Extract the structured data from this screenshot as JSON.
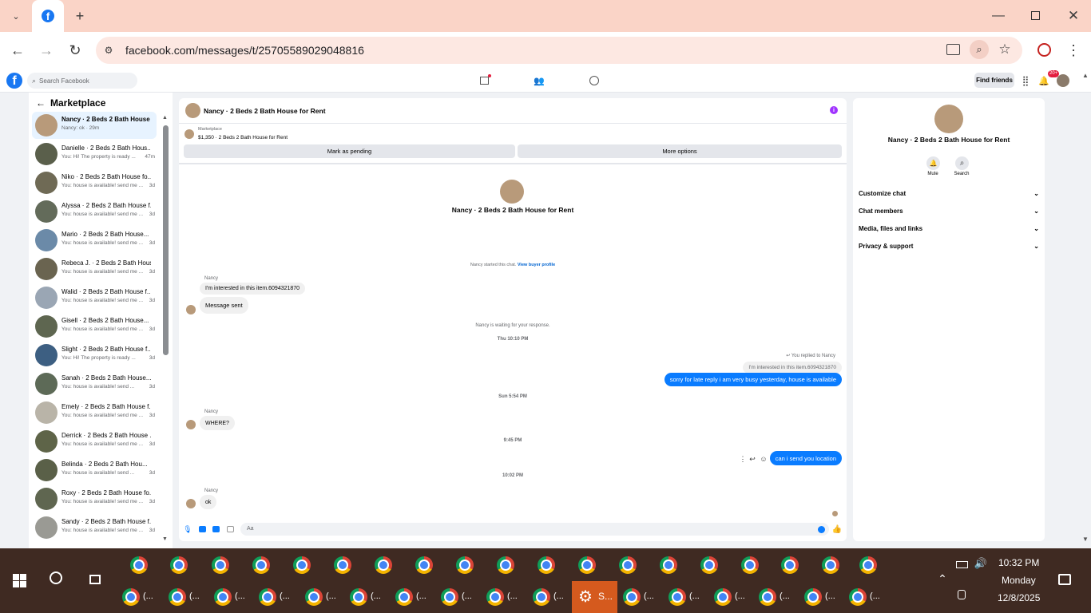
{
  "browser": {
    "url": "facebook.com/messages/t/25705589029048816"
  },
  "fb": {
    "search_placeholder": "Search Facebook",
    "find_friends": "Find friends",
    "notif_badge": "20+"
  },
  "sidebar": {
    "title": "Marketplace",
    "items": [
      {
        "title": "Nancy · 2 Beds 2 Bath House f...",
        "sub": "Nancy: ok · 29m",
        "time": "",
        "color": "#b89a7a"
      },
      {
        "title": "Danielle · 2 Beds 2 Bath Hous...",
        "sub": "You: Hi! The property is ready ...",
        "time": "47m",
        "color": "#5a5f4b"
      },
      {
        "title": "Niko · 2 Beds 2 Bath House fo...",
        "sub": "You: house is available! send me ...",
        "time": "3d",
        "color": "#6f6a55"
      },
      {
        "title": "Alyssa · 2 Beds 2 Bath House f...",
        "sub": "You: house is available! send me ...",
        "time": "3d",
        "color": "#636b5a"
      },
      {
        "title": "Mario · 2 Beds 2 Bath House...",
        "sub": "You: house is available! send me ...",
        "time": "3d",
        "color": "#6b8aa8"
      },
      {
        "title": "Rebeca J. · 2 Beds 2 Bath Hous...",
        "sub": "You: house is available! send me ...",
        "time": "3d",
        "color": "#6a6450"
      },
      {
        "title": "Walid · 2 Beds 2 Bath House f...",
        "sub": "You: house is available! send me ...",
        "time": "3d",
        "color": "#9aa6b4"
      },
      {
        "title": "Gisell · 2 Beds 2 Bath House...",
        "sub": "You: house is available! send me ...",
        "time": "3d",
        "color": "#5e6650"
      },
      {
        "title": "Slight · 2 Beds 2 Bath House f...",
        "sub": "You: Hi! The property is ready ...",
        "time": "3d",
        "color": "#3d5f82"
      },
      {
        "title": "Sanah · 2 Beds 2 Bath House...",
        "sub": "You: house is available! send ...",
        "time": "3d",
        "color": "#5d6a57"
      },
      {
        "title": "Emely · 2 Beds 2 Bath House f...",
        "sub": "You: house is available! send me ...",
        "time": "3d",
        "color": "#b9b4a8"
      },
      {
        "title": "Derrick · 2 Beds 2 Bath House ...",
        "sub": "You: house is available! send me ...",
        "time": "3d",
        "color": "#5e6448"
      },
      {
        "title": "Belinda · 2 Beds 2 Bath Hou...",
        "sub": "You: house is available! send ...",
        "time": "3d",
        "color": "#5a6048"
      },
      {
        "title": "Roxy · 2 Beds 2 Bath House fo...",
        "sub": "You: house is available! send me ...",
        "time": "3d",
        "color": "#5f6650"
      },
      {
        "title": "Sandy · 2 Beds 2 Bath House f...",
        "sub": "You: house is available! send me ...",
        "time": "3d",
        "color": "#9a9a94"
      }
    ]
  },
  "chat": {
    "header_title": "Nancy · 2 Beds 2 Bath House for Rent",
    "listing_source": "Marketplace",
    "listing_line": "$1,350 · 2 Beds 2 Bath House for Rent",
    "mark_pending": "Mark as pending",
    "more_options": "More options",
    "profile_name": "Nancy · 2 Beds 2 Bath House for Rent",
    "started_text": "Nancy started this chat.",
    "buyer_profile_link": "View buyer profile",
    "sender_name": "Nancy",
    "msg1": "I'm interested in this item.6094321870",
    "msg2": "Message sent",
    "waiting_text": "Nancy is waiting for your response.",
    "ts1": "Thu 10:10 PM",
    "replied_to": "You replied to Nancy",
    "quoted": "I'm interested in this item.6094321870",
    "out1": "sorry for late reply i am very busy yesterday, house is available",
    "ts2": "Sun 5:54 PM",
    "msg3": "WHERE?",
    "ts3": "9:45 PM",
    "out2": "can i send you location",
    "ts4": "10:02 PM",
    "msg4": "ok",
    "composer_placeholder": "Aa"
  },
  "info": {
    "name": "Nancy · 2 Beds 2 Bath House for Rent",
    "mute": "Mute",
    "search": "Search",
    "rows": [
      "Customize chat",
      "Chat members",
      "Media, files and links",
      "Privacy & support"
    ]
  },
  "taskbar": {
    "time": "10:32 PM",
    "day": "Monday",
    "date": "12/8/2025",
    "settings_label": "S...",
    "window_label": "(..."
  }
}
